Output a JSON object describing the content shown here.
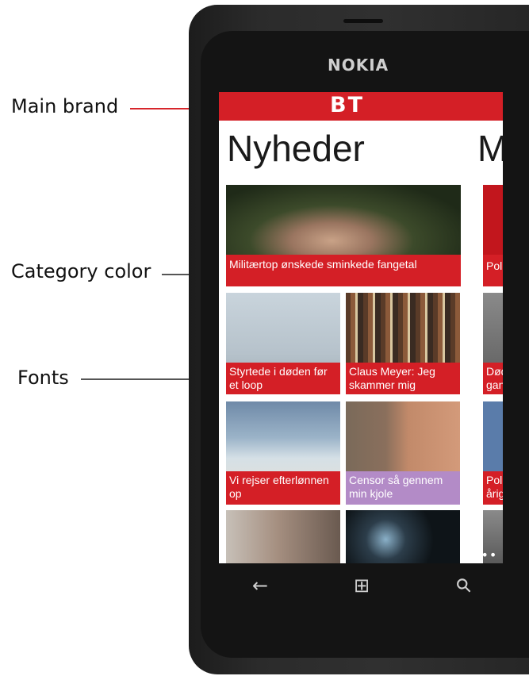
{
  "annotations": {
    "main_brand": "Main brand",
    "category_color": "Category color",
    "fonts": "Fonts"
  },
  "device": {
    "brand": "NOKIA"
  },
  "app": {
    "logo": "BT",
    "section_title": "Nyheder",
    "next_section_initial": "M"
  },
  "tiles": [
    {
      "caption": "Militærtop ønskede sminkede fangetal",
      "image": "man-portrait",
      "color": "#d41f26"
    },
    {
      "caption": "Styrtede i døden før et loop",
      "image": "jet-plane",
      "color": "#d41f26"
    },
    {
      "caption": "Claus Meyer: Jeg skammer mig",
      "image": "man-with-shelves",
      "color": "#d41f26"
    },
    {
      "caption": "Vi rejser efterlønnen op",
      "image": "beach-boat",
      "color": "#d41f26"
    },
    {
      "caption": "Censor så gennem min kjole",
      "image": "woman-portrait",
      "color": "#b38bc7"
    },
    {
      "caption": "",
      "image": "men-portraits",
      "color": ""
    },
    {
      "caption": "",
      "image": "eye-closeup",
      "color": ""
    }
  ],
  "side_tiles": [
    {
      "caption": "Poli"
    },
    {
      "caption": "Død gan"
    },
    {
      "caption": "Poli årig"
    }
  ],
  "nav": {
    "back_icon": "←",
    "start_icon": "⊞",
    "search_icon": "⚲",
    "more": "•••"
  },
  "colors": {
    "brand_red": "#d41f26",
    "category_purple": "#b38bc7"
  }
}
